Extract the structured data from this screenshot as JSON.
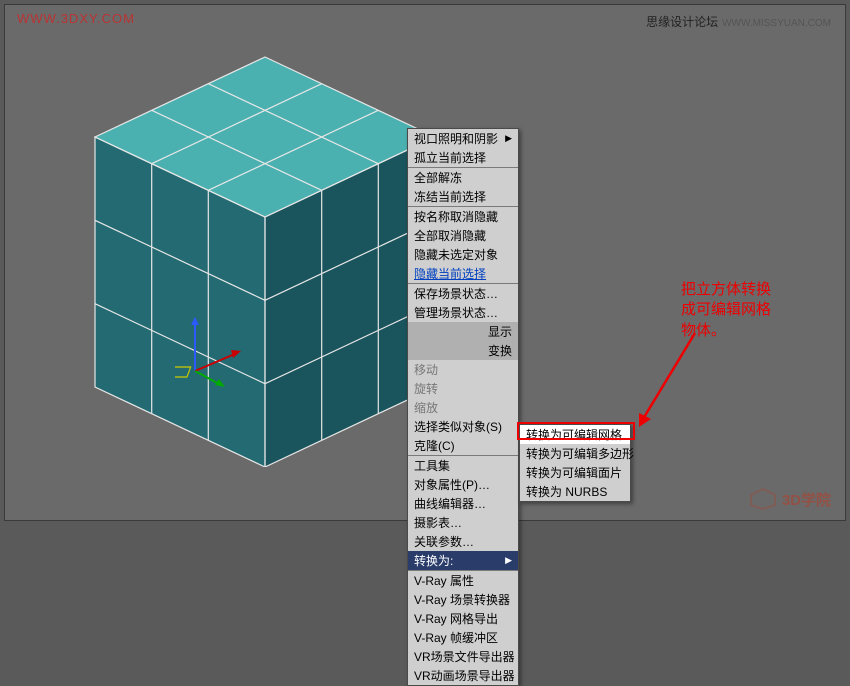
{
  "watermarks": {
    "top_left": "WWW.3DXY.COM",
    "top_right": "思缘设计论坛",
    "top_right_sub": "WWW.MISSYUAN.COM",
    "bottom_right": "3D学院"
  },
  "annotation": {
    "text_l1": "把立方体转换",
    "text_l2": "成可编辑网格",
    "text_l3": "物体。"
  },
  "menu_sections": [
    {
      "items": [
        {
          "label": "视口照明和阴影",
          "sub": true
        },
        {
          "label": "孤立当前选择"
        }
      ]
    },
    {
      "items": [
        {
          "label": "全部解冻"
        },
        {
          "label": "冻结当前选择"
        }
      ]
    },
    {
      "items": [
        {
          "label": "按名称取消隐藏"
        },
        {
          "label": "全部取消隐藏"
        },
        {
          "label": "隐藏未选定对象"
        },
        {
          "label": "隐藏当前选择",
          "link": true
        }
      ]
    },
    {
      "items": [
        {
          "label": "保存场景状态…"
        },
        {
          "label": "管理场景状态…"
        }
      ]
    },
    {
      "header": "显示"
    },
    {
      "header": "变换"
    },
    {
      "items": [
        {
          "label": "移动",
          "dim": true
        },
        {
          "label": "旋转",
          "dim": true
        },
        {
          "label": "缩放",
          "dim": true
        },
        {
          "label": "选择类似对象(S)"
        },
        {
          "label": "克隆(C)"
        }
      ]
    },
    {
      "items": [
        {
          "label": "工具集"
        },
        {
          "label": "对象属性(P)…"
        },
        {
          "label": "曲线编辑器…"
        },
        {
          "label": "摄影表…"
        },
        {
          "label": "关联参数…"
        },
        {
          "label": "转换为:",
          "sub": true,
          "highlight": true
        }
      ]
    },
    {
      "items": [
        {
          "label": "V-Ray 属性"
        },
        {
          "label": "V-Ray 场景转换器"
        },
        {
          "label": "V-Ray 网格导出"
        },
        {
          "label": "V-Ray 帧缓冲区"
        },
        {
          "label": "VR场景文件导出器"
        },
        {
          "label": "VR动画场景导出器"
        }
      ]
    }
  ],
  "submenu": [
    {
      "label": "转换为可编辑网格",
      "hot": true
    },
    {
      "label": "转换为可编辑多边形"
    },
    {
      "label": "转换为可编辑面片"
    },
    {
      "label": "转换为 NURBS"
    }
  ],
  "colors": {
    "cube_top": "#4ab0b0",
    "cube_side_l": "#236a72",
    "cube_side_r": "#1a545c",
    "edge": "#e6e6e6"
  }
}
